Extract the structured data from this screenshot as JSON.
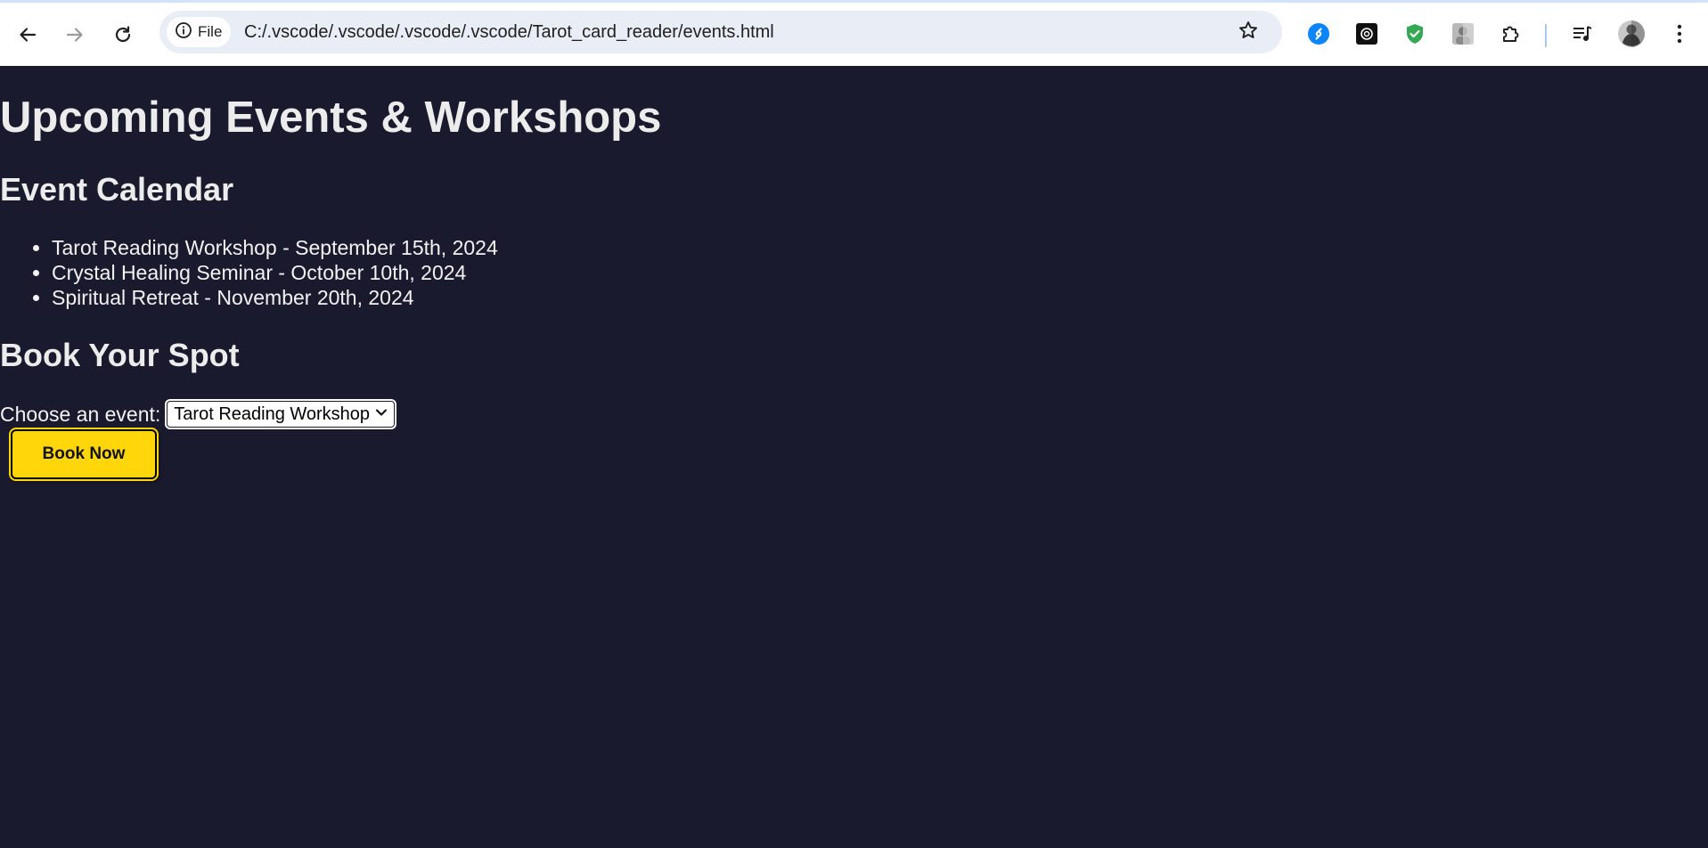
{
  "browser": {
    "back_icon": "arrow-left-icon",
    "forward_icon": "arrow-right-icon",
    "reload_icon": "reload-icon",
    "site_chip_label": "File",
    "url": "C:/.vscode/.vscode/.vscode/.vscode/Tarot_card_reader/events.html",
    "bookmark_icon": "star-icon",
    "extensions": [
      "shazam-icon",
      "chatgpt-icon",
      "shield-check-icon",
      "profile-image-icon",
      "puzzle-icon"
    ],
    "media_icon": "media-controls-icon",
    "menu_icon": "kebab-menu-icon"
  },
  "page": {
    "title": "Upcoming Events & Workshops",
    "calendar_heading": "Event Calendar",
    "events": [
      "Tarot Reading Workshop - September 15th, 2024",
      "Crystal Healing Seminar - October 10th, 2024",
      "Spiritual Retreat - November 20th, 2024"
    ],
    "booking_heading": "Book Your Spot",
    "choose_label": "Choose an event:",
    "selected_event": "Tarot Reading Workshop",
    "book_button": "Book Now"
  },
  "colors": {
    "page_background": "#1a1a2e",
    "button_background": "#ffd60a",
    "text": "#ececec"
  }
}
